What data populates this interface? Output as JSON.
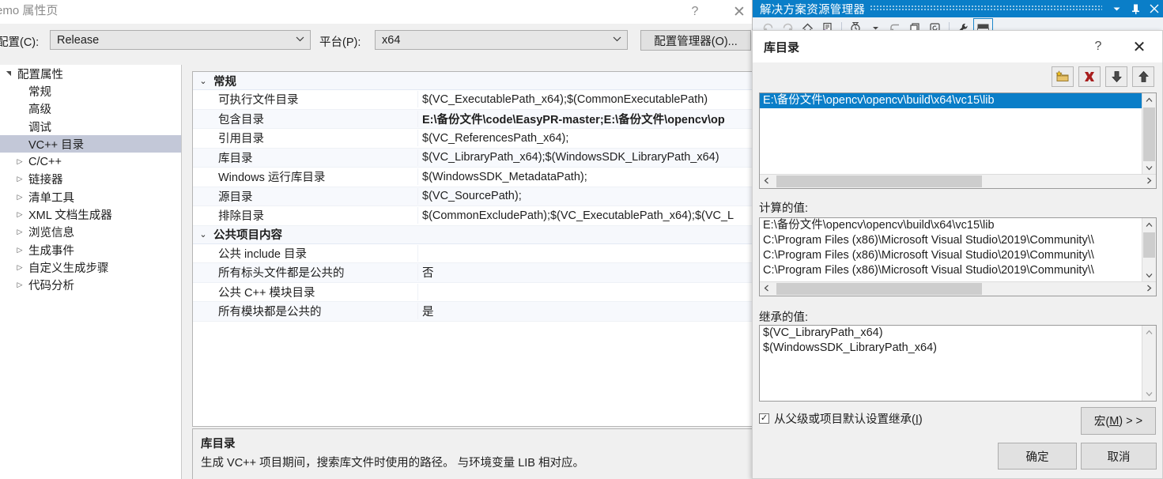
{
  "solution_explorer": {
    "title": "解决方案资源管理器",
    "buttons": [
      {
        "name": "dropdown",
        "glyph": "▾"
      },
      {
        "name": "pin",
        "glyph": "⏻"
      },
      {
        "name": "close",
        "glyph": "✕"
      }
    ],
    "toolbar_icons": [
      "back-icon",
      "forward-icon",
      "home-icon",
      "sync-with-active-document-icon",
      "pending-changes-filter-icon",
      "collapse-all-icon",
      "show-all-files-icon",
      "refresh-icon",
      "properties-wrench-icon",
      "preview-selected-items-icon"
    ]
  },
  "property_pages": {
    "title": "emo 属性页",
    "help_glyph": "?",
    "close_glyph": "✕",
    "config_label": "配置(C):",
    "config_value": "Release",
    "platform_label": "平台(P):",
    "platform_value": "x64",
    "config_manager_button": "配置管理器(O)...",
    "tree": [
      {
        "label": "配置属性",
        "indent": 0,
        "arrow": "down",
        "selected": false
      },
      {
        "label": "常规",
        "indent": 1,
        "arrow": "none",
        "selected": false
      },
      {
        "label": "高级",
        "indent": 1,
        "arrow": "none",
        "selected": false
      },
      {
        "label": "调试",
        "indent": 1,
        "arrow": "none",
        "selected": false
      },
      {
        "label": "VC++ 目录",
        "indent": 1,
        "arrow": "none",
        "selected": true
      },
      {
        "label": "C/C++",
        "indent": 1,
        "arrow": "right",
        "selected": false
      },
      {
        "label": "链接器",
        "indent": 1,
        "arrow": "right",
        "selected": false
      },
      {
        "label": "清单工具",
        "indent": 1,
        "arrow": "right",
        "selected": false
      },
      {
        "label": "XML 文档生成器",
        "indent": 1,
        "arrow": "right",
        "selected": false
      },
      {
        "label": "浏览信息",
        "indent": 1,
        "arrow": "right",
        "selected": false
      },
      {
        "label": "生成事件",
        "indent": 1,
        "arrow": "right",
        "selected": false
      },
      {
        "label": "自定义生成步骤",
        "indent": 1,
        "arrow": "right",
        "selected": false
      },
      {
        "label": "代码分析",
        "indent": 1,
        "arrow": "right",
        "selected": false
      }
    ],
    "grid": [
      {
        "kind": "category",
        "label": "常规",
        "chev": "⌄"
      },
      {
        "kind": "row",
        "name": "可执行文件目录",
        "value": "$(VC_ExecutablePath_x64);$(CommonExecutablePath)",
        "bold": false,
        "alt": false
      },
      {
        "kind": "row",
        "name": "包含目录",
        "value": "E:\\备份文件\\code\\EasyPR-master;E:\\备份文件\\opencv\\op",
        "bold": true,
        "alt": true
      },
      {
        "kind": "row",
        "name": "引用目录",
        "value": "$(VC_ReferencesPath_x64);",
        "bold": false,
        "alt": false
      },
      {
        "kind": "row",
        "name": "库目录",
        "value": "$(VC_LibraryPath_x64);$(WindowsSDK_LibraryPath_x64)",
        "bold": false,
        "alt": true
      },
      {
        "kind": "row",
        "name": "Windows 运行库目录",
        "value": "$(WindowsSDK_MetadataPath);",
        "bold": false,
        "alt": false
      },
      {
        "kind": "row",
        "name": "源目录",
        "value": "$(VC_SourcePath);",
        "bold": false,
        "alt": true
      },
      {
        "kind": "row",
        "name": "排除目录",
        "value": "$(CommonExcludePath);$(VC_ExecutablePath_x64);$(VC_L",
        "bold": false,
        "alt": false
      },
      {
        "kind": "category",
        "label": "公共项目内容",
        "chev": "⌄"
      },
      {
        "kind": "row",
        "name": "公共 include 目录",
        "value": "",
        "bold": false,
        "alt": false
      },
      {
        "kind": "row",
        "name": "所有标头文件都是公共的",
        "value": "否",
        "bold": false,
        "alt": true
      },
      {
        "kind": "row",
        "name": "公共 C++ 模块目录",
        "value": "",
        "bold": false,
        "alt": false
      },
      {
        "kind": "row",
        "name": "所有模块都是公共的",
        "value": "是",
        "bold": false,
        "alt": true
      }
    ],
    "description": {
      "title": "库目录",
      "text": "生成 VC++ 项目期间，搜索库文件时使用的路径。  与环境变量 LIB 相对应。"
    }
  },
  "library_dialog": {
    "title": "库目录",
    "help_glyph": "?",
    "close_glyph": "✕",
    "toolbar": [
      {
        "name": "new-folder-button",
        "glyph": "folder"
      },
      {
        "name": "delete-button",
        "glyph": "x"
      },
      {
        "name": "move-down-button",
        "glyph": "↓"
      },
      {
        "name": "move-up-button",
        "glyph": "↑"
      }
    ],
    "entries": [
      {
        "text": "E:\\备份文件\\opencv\\opencv\\build\\x64\\vc15\\lib",
        "selected": true
      }
    ],
    "evaluated_label": "计算的值:",
    "evaluated_values": [
      "E:\\备份文件\\opencv\\opencv\\build\\x64\\vc15\\lib",
      "C:\\Program Files (x86)\\Microsoft Visual Studio\\2019\\Community\\\\",
      "C:\\Program Files (x86)\\Microsoft Visual Studio\\2019\\Community\\\\",
      "C:\\Program Files (x86)\\Microsoft Visual Studio\\2019\\Community\\\\"
    ],
    "inherited_label": "继承的值:",
    "inherited_values": [
      "$(VC_LibraryPath_x64)",
      "$(WindowsSDK_LibraryPath_x64)"
    ],
    "inherit_checkbox": {
      "checked": true,
      "check_glyph": "✓",
      "label_pre": "从父级或项目默认设置继承(",
      "label_key": "I",
      "label_post": ")"
    },
    "macros_button": {
      "pre": "宏(",
      "key": "M",
      "post": ") > >"
    },
    "ok_button": "确定",
    "cancel_button": "取消"
  },
  "colors": {
    "accent_blue": "#0a7ec8",
    "selection_gray": "#c3c8d8",
    "dialog_bg": "#f0f0f0",
    "delete_red": "#a81e1e",
    "folder_yellow": "#e8c36a"
  }
}
